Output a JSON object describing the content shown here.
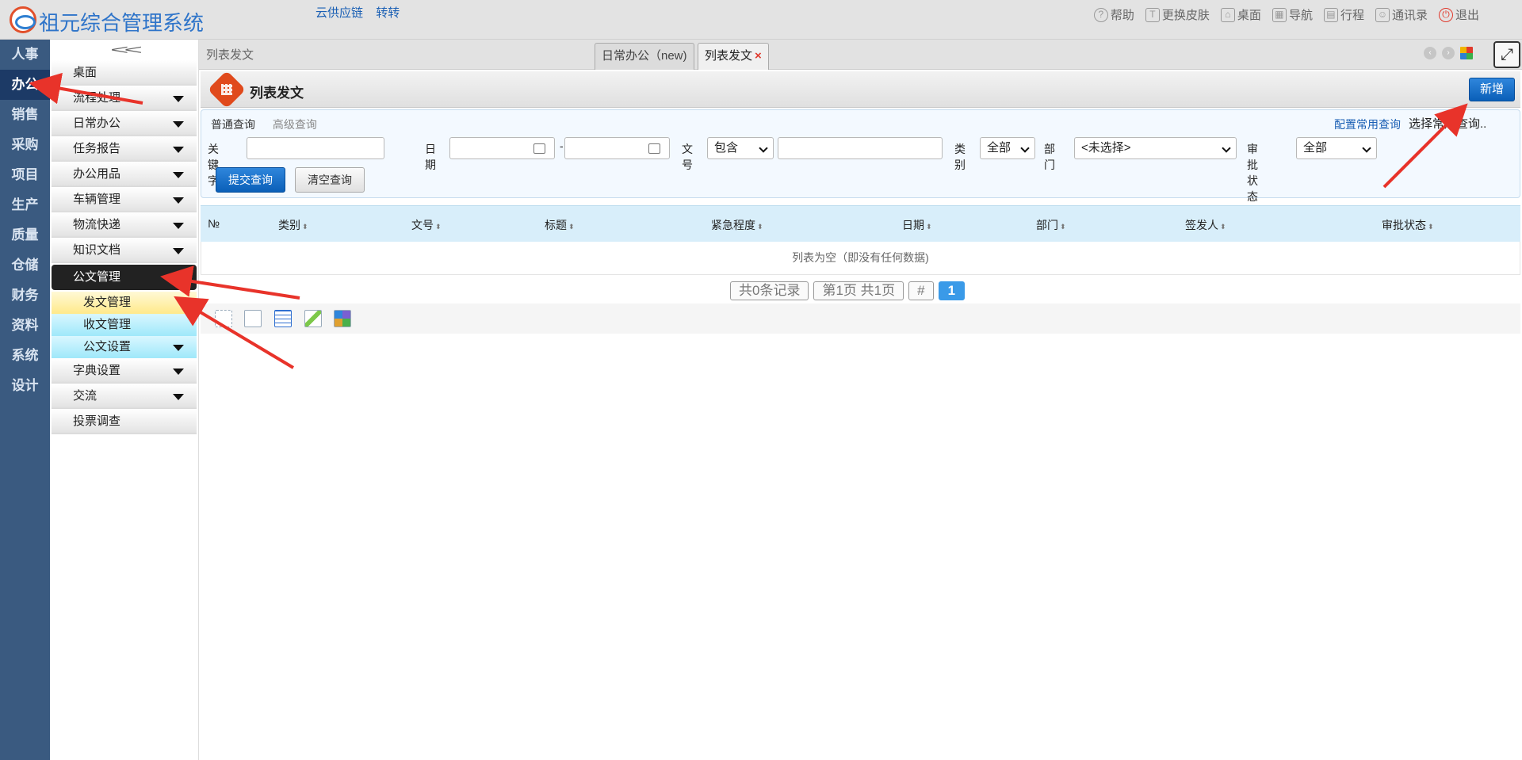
{
  "app": {
    "title": "祖元综合管理系统"
  },
  "top_links": [
    "云供应链",
    "转转"
  ],
  "top_right": [
    {
      "icon": "help-icon",
      "glyph": "?",
      "label": "帮助"
    },
    {
      "icon": "shirt-icon",
      "glyph": "T",
      "label": "更换皮肤"
    },
    {
      "icon": "home-icon",
      "glyph": "⌂",
      "label": "桌面"
    },
    {
      "icon": "grid-icon",
      "glyph": "▦",
      "label": "导航"
    },
    {
      "icon": "calendar-icon",
      "glyph": "▤",
      "label": "行程"
    },
    {
      "icon": "contacts-icon",
      "glyph": "☺",
      "label": "通讯录"
    },
    {
      "icon": "power-icon",
      "glyph": "⏻",
      "label": "退出"
    }
  ],
  "left_nav": [
    "人事",
    "办公",
    "销售",
    "采购",
    "项目",
    "生产",
    "质量",
    "仓储",
    "财务",
    "资料",
    "系统",
    "设计"
  ],
  "left_nav_active": "办公",
  "submenu": {
    "items": [
      {
        "label": "桌面",
        "arrow": false,
        "style": "normal"
      },
      {
        "label": "流程处理",
        "arrow": true,
        "style": "normal"
      },
      {
        "label": "日常办公",
        "arrow": true,
        "style": "normal"
      },
      {
        "label": "任务报告",
        "arrow": true,
        "style": "normal"
      },
      {
        "label": "办公用品",
        "arrow": true,
        "style": "normal"
      },
      {
        "label": "车辆管理",
        "arrow": true,
        "style": "normal"
      },
      {
        "label": "物流快递",
        "arrow": true,
        "style": "normal"
      },
      {
        "label": "知识文档",
        "arrow": true,
        "style": "normal"
      },
      {
        "label": "公文管理",
        "arrow": true,
        "style": "dark"
      },
      {
        "label": "发文管理",
        "arrow": false,
        "style": "sub yellow"
      },
      {
        "label": "收文管理",
        "arrow": false,
        "style": "sub cyan"
      },
      {
        "label": "公文设置",
        "arrow": true,
        "style": "sub cyan"
      },
      {
        "label": "字典设置",
        "arrow": true,
        "style": "normal"
      },
      {
        "label": "交流",
        "arrow": true,
        "style": "normal"
      },
      {
        "label": "投票调查",
        "arrow": false,
        "style": "normal"
      }
    ]
  },
  "tabs": {
    "breadcrumb": "列表发文",
    "items": [
      {
        "label": "日常办公（new)",
        "active": false
      },
      {
        "label": "列表发文",
        "active": true,
        "close": "×"
      }
    ]
  },
  "page": {
    "title": "列表发文",
    "new_button": "新增"
  },
  "query": {
    "tab_normal": "普通查询",
    "tab_advanced": "高级查询",
    "config_link": "配置常用查询",
    "common_select": "选择常用查询..",
    "keyword_label": "关键字",
    "keyword_value": "",
    "date_label": "日期",
    "date_from": "",
    "date_sep": "-",
    "date_to": "",
    "docno_label": "文号",
    "docno_op": "包含",
    "docno_value": "",
    "category_label": "类别",
    "category_value": "全部",
    "dept_label": "部门",
    "dept_value": "<未选择>",
    "approval_label": "审批状态",
    "approval_value": "全部",
    "submit_button": "提交查询",
    "clear_button": "清空查询"
  },
  "grid": {
    "columns": [
      "№",
      "类别",
      "文号",
      "标题",
      "紧急程度",
      "日期",
      "部门",
      "签发人",
      "审批状态"
    ],
    "empty_text": "列表为空（即没有任何数据)"
  },
  "pager": {
    "total": "共0条记录",
    "page_info": "第1页 共1页",
    "hash": "#",
    "current": "1"
  },
  "colors": {
    "accent": "#0a5fb8",
    "nav_bg": "#3a5a80",
    "annotation": "#e8332a"
  }
}
